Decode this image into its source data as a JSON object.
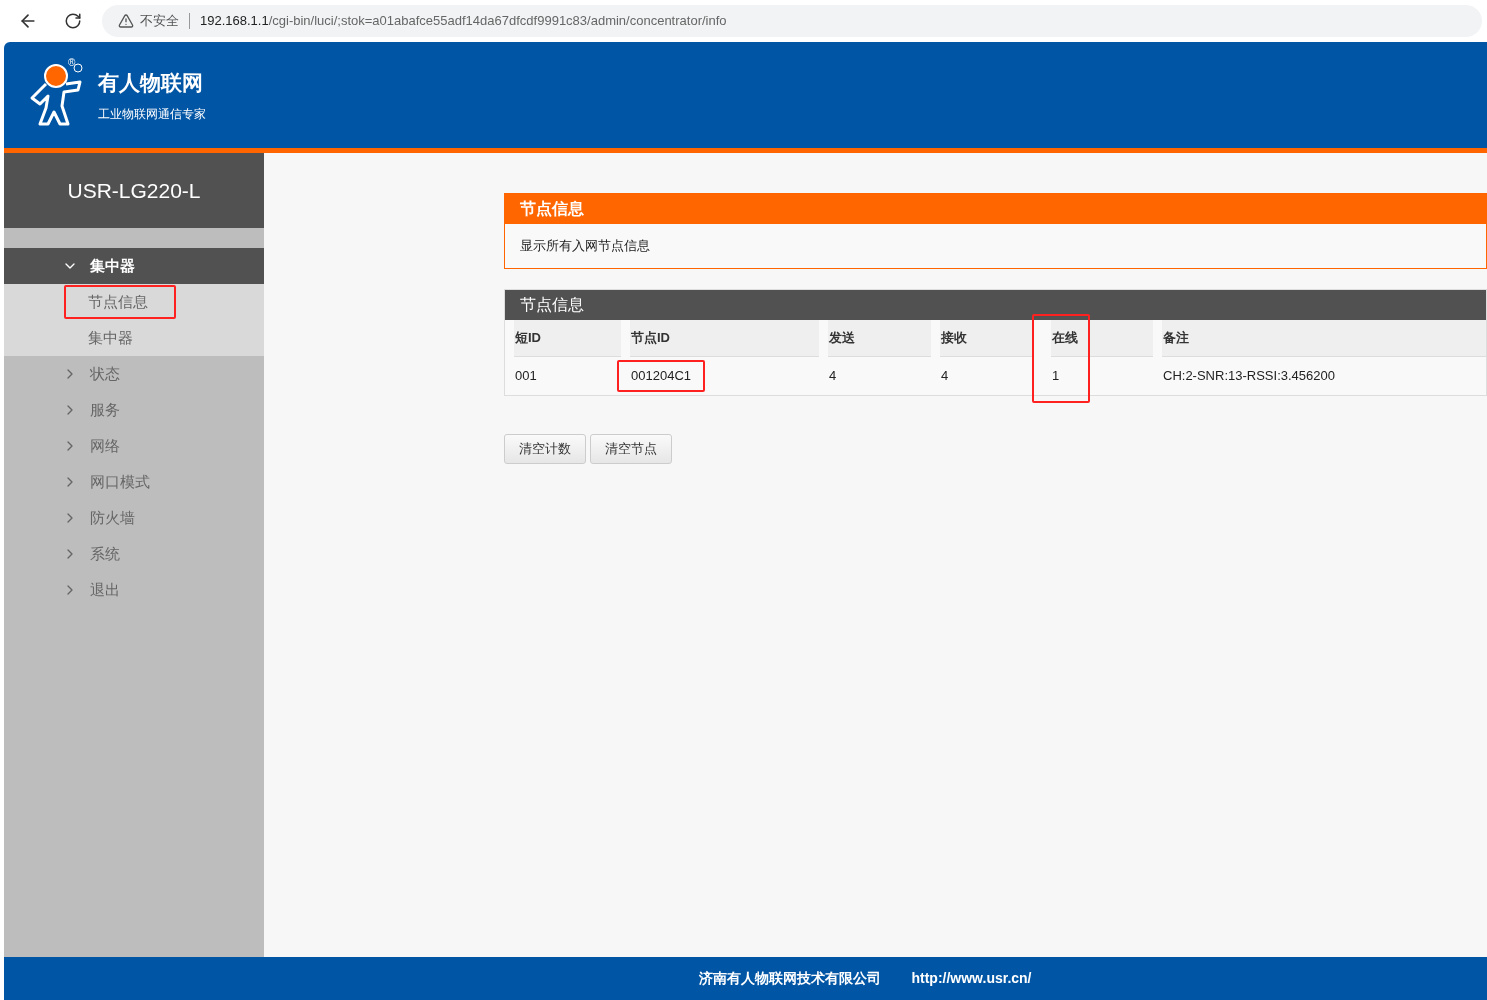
{
  "browser": {
    "security": "不安全",
    "url_host": "192.168.1.1",
    "url_path": "/cgi-bin/luci/;stok=a01abafce55adf14da67dfcdf9991c83/admin/concentrator/info"
  },
  "brand": {
    "name": "有人物联网",
    "slogan": "工业物联网通信专家",
    "mark": "®"
  },
  "sidebar": {
    "device": "USR-LG220-L",
    "items": [
      {
        "label": "集中器",
        "expanded": true,
        "children": [
          {
            "label": "节点信息",
            "annotated": true
          },
          {
            "label": "集中器",
            "annotated": false
          }
        ]
      },
      {
        "label": "状态",
        "expanded": false
      },
      {
        "label": "服务",
        "expanded": false
      },
      {
        "label": "网络",
        "expanded": false
      },
      {
        "label": "网口模式",
        "expanded": false
      },
      {
        "label": "防火墙",
        "expanded": false
      },
      {
        "label": "系统",
        "expanded": false
      },
      {
        "label": "退出",
        "expanded": false
      }
    ]
  },
  "info_panel": {
    "title": "节点信息",
    "description": "显示所有入网节点信息"
  },
  "table": {
    "title": "节点信息",
    "columns": [
      {
        "label": "短ID",
        "annotated": false
      },
      {
        "label": "节点ID",
        "annotated": false
      },
      {
        "label": "发送",
        "annotated": false
      },
      {
        "label": "接收",
        "annotated": false
      },
      {
        "label": "在线",
        "annotated": true
      },
      {
        "label": "备注",
        "annotated": false
      }
    ],
    "rows": [
      {
        "cells": [
          {
            "text": "001",
            "annotated": false
          },
          {
            "text": "001204C1",
            "annotated": true
          },
          {
            "text": "4",
            "annotated": false
          },
          {
            "text": "4",
            "annotated": false
          },
          {
            "text": "1",
            "annotated": false
          },
          {
            "text": "CH:2-SNR:13-RSSI:3.456200",
            "annotated": false
          }
        ]
      }
    ]
  },
  "buttons": [
    "清空计数",
    "清空节点"
  ],
  "footer": {
    "company": "济南有人物联网技术有限公司",
    "url": "http://www.usr.cn/"
  }
}
